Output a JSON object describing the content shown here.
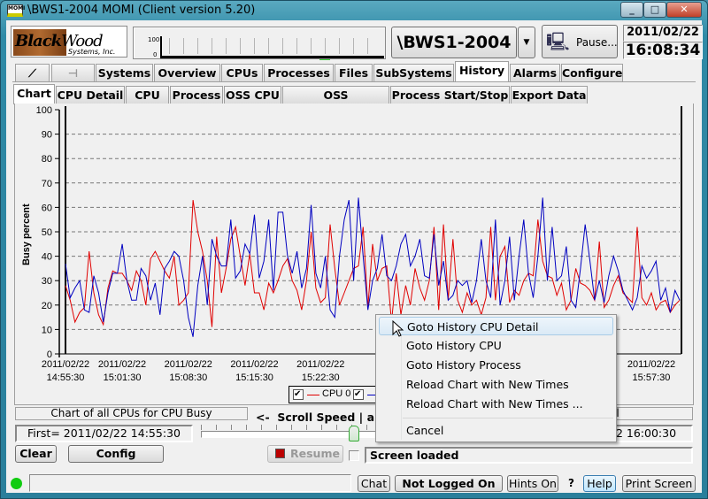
{
  "window": {
    "title": "\\BWS1-2004 MOMI (Client version 5.20)",
    "app_icon": "MOMI",
    "controls": [
      "minimize",
      "maximize",
      "close"
    ]
  },
  "header": {
    "logo": "BlackWood Systems, Inc.",
    "mini_graph": {
      "y_max_label": "100",
      "y_min_label": "0"
    },
    "system": "\\BWS1-2004",
    "pause_label": "Pause...",
    "date": "2011/02/22",
    "time": "16:08:34"
  },
  "main_tabs": [
    {
      "label": "Systems"
    },
    {
      "label": "Overview"
    },
    {
      "label": "CPUs"
    },
    {
      "label": "Processes"
    },
    {
      "label": "Files"
    },
    {
      "label": "SubSystems"
    },
    {
      "label": "History",
      "selected": true
    },
    {
      "label": "Alarms"
    },
    {
      "label": "Configure"
    }
  ],
  "sub_tabs": [
    {
      "label": "Chart",
      "selected": true
    },
    {
      "label": "CPU Detail"
    },
    {
      "label": "CPU"
    },
    {
      "label": "Process"
    },
    {
      "label": "OSS CPU"
    },
    {
      "label": "OSS NameServer"
    },
    {
      "label": "Process Start/Stop"
    },
    {
      "label": "Export Data"
    }
  ],
  "chart_data": {
    "type": "line",
    "ylabel": "Busy percent",
    "ylim": [
      0,
      100
    ],
    "yticks": [
      0,
      10,
      20,
      30,
      40,
      50,
      60,
      70,
      80,
      90,
      100
    ],
    "x_start": "2011/02/22 14:55:30",
    "x_end": "2011/02/22 16:00:30",
    "xticks": [
      {
        "date": "2011/02/22",
        "time": "14:55:30"
      },
      {
        "date": "2011/02/22",
        "time": "15:01:30"
      },
      {
        "date": "2011/02/22",
        "time": "15:08:30"
      },
      {
        "date": "2011/02/22",
        "time": "15:15:30"
      },
      {
        "date": "2011/02/22",
        "time": "15:22:30"
      },
      {
        "date": "2011/02/22",
        "time": "15:57:30"
      }
    ],
    "grid": true,
    "legend": "bottom",
    "series": [
      {
        "name": "CPU 0",
        "color": "#e00000",
        "values": [
          28,
          22,
          13,
          17,
          19,
          42,
          25,
          16,
          12,
          27,
          34,
          33,
          33,
          30,
          26,
          34,
          30,
          20,
          39,
          42,
          38,
          34,
          31,
          40,
          20,
          22,
          25,
          63,
          50,
          42,
          30,
          11,
          48,
          25,
          35,
          47,
          52,
          40,
          28,
          41,
          25,
          25,
          18,
          29,
          25,
          30,
          36,
          39,
          30,
          26,
          18,
          30,
          50,
          27,
          21,
          23,
          53,
          35,
          20,
          25,
          30,
          35,
          36,
          52,
          19,
          45,
          30,
          35,
          36,
          13,
          33,
          16,
          28,
          20,
          35,
          27,
          22,
          30,
          52,
          18,
          53,
          22,
          47,
          22,
          17,
          25,
          20,
          22,
          16,
          23,
          52,
          22,
          40,
          44,
          21,
          26,
          24,
          30,
          33,
          32,
          55,
          38,
          32,
          31,
          24,
          29,
          18,
          22,
          35,
          29,
          28,
          26,
          22,
          46,
          19,
          22,
          28,
          32,
          25,
          23,
          21,
          52,
          23,
          20,
          25,
          18,
          21,
          22,
          17,
          20,
          22
        ]
      },
      {
        "color": "#0000c0",
        "values": [
          37,
          23,
          27,
          30,
          18,
          17,
          32,
          25,
          13,
          25,
          33,
          33,
          45,
          30,
          22,
          22,
          35,
          32,
          22,
          29,
          16,
          35,
          38,
          42,
          40,
          30,
          15,
          7,
          28,
          40,
          20,
          47,
          40,
          36,
          36,
          55,
          31,
          34,
          45,
          41,
          57,
          31,
          38,
          55,
          26,
          58,
          58,
          40,
          33,
          42,
          27,
          35,
          61,
          33,
          27,
          40,
          18,
          15,
          40,
          55,
          63,
          30,
          64,
          40,
          18,
          30,
          35,
          49,
          32,
          30,
          36,
          45,
          49,
          36,
          40,
          47,
          32,
          31,
          49,
          28,
          38,
          22,
          24,
          30,
          28,
          30,
          21,
          30,
          47,
          30,
          23,
          55,
          20,
          30,
          48,
          22,
          40,
          55,
          33,
          23,
          40,
          64,
          30,
          52,
          30,
          32,
          44,
          22,
          19,
          35,
          53,
          38,
          22,
          30,
          21,
          32,
          40,
          34,
          26,
          22,
          18,
          23,
          36,
          31,
          34,
          38,
          22,
          27,
          17,
          26,
          22
        ]
      }
    ]
  },
  "controls": {
    "chart_desc": "Chart of all CPUs for CPU Busy",
    "scroll_label": "<-  Scroll Speed | an",
    "first": "First= 2011/02/22 14:55:30",
    "right_desc": "al",
    "last": "22 16:00:30",
    "clear": "Clear",
    "config": "Config",
    "resume": "Resume",
    "status": "Screen loaded"
  },
  "context_menu": {
    "items": [
      "Goto History CPU Detail",
      "Goto History CPU",
      "Goto History Process",
      "Reload Chart with New Times",
      "Reload Chart with New Times ..."
    ],
    "cancel": "Cancel"
  },
  "statusbar": {
    "chat": "Chat",
    "login": "Not Logged On",
    "hints": "Hints On",
    "question": "?",
    "help": "Help",
    "print": "Print Screen"
  }
}
